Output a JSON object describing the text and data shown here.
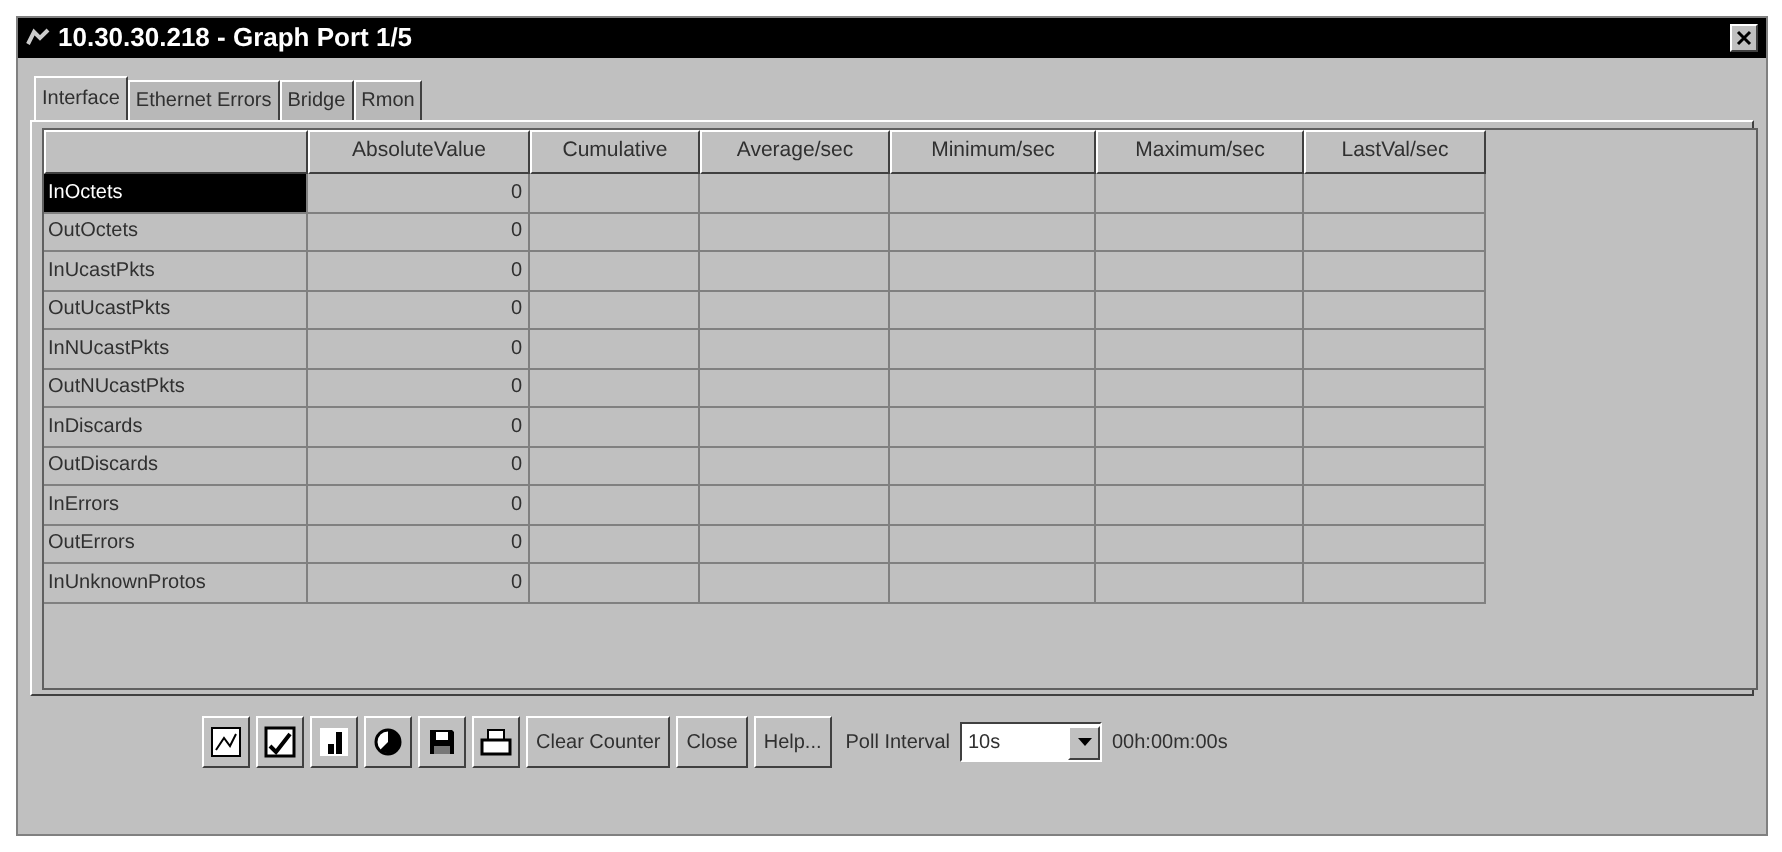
{
  "window": {
    "title": "10.30.30.218 - Graph Port 1/5"
  },
  "tabs": [
    {
      "label": "Interface",
      "selected": true
    },
    {
      "label": "Ethernet Errors",
      "selected": false
    },
    {
      "label": "Bridge",
      "selected": false
    },
    {
      "label": "Rmon",
      "selected": false
    }
  ],
  "table": {
    "columns": [
      "AbsoluteValue",
      "Cumulative",
      "Average/sec",
      "Minimum/sec",
      "Maximum/sec",
      "LastVal/sec"
    ],
    "rows": [
      {
        "name": "InOctets",
        "absolute_value": "0",
        "selected": true
      },
      {
        "name": "OutOctets",
        "absolute_value": "0",
        "selected": false
      },
      {
        "name": "InUcastPkts",
        "absolute_value": "0",
        "selected": false
      },
      {
        "name": "OutUcastPkts",
        "absolute_value": "0",
        "selected": false
      },
      {
        "name": "InNUcastPkts",
        "absolute_value": "0",
        "selected": false
      },
      {
        "name": "OutNUcastPkts",
        "absolute_value": "0",
        "selected": false
      },
      {
        "name": "InDiscards",
        "absolute_value": "0",
        "selected": false
      },
      {
        "name": "OutDiscards",
        "absolute_value": "0",
        "selected": false
      },
      {
        "name": "InErrors",
        "absolute_value": "0",
        "selected": false
      },
      {
        "name": "OutErrors",
        "absolute_value": "0",
        "selected": false
      },
      {
        "name": "InUnknownProtos",
        "absolute_value": "0",
        "selected": false
      }
    ]
  },
  "toolbar": {
    "icon_buttons": [
      {
        "kind": "line"
      },
      {
        "kind": "checkline"
      },
      {
        "kind": "bar"
      },
      {
        "kind": "pie"
      },
      {
        "kind": "save"
      },
      {
        "kind": "print"
      }
    ],
    "buttons": [
      "Clear Counter",
      "Close",
      "Help..."
    ],
    "poll_interval": {
      "label": "Poll Interval",
      "value": "10s"
    },
    "elapsed": "00h:00m:00s"
  }
}
